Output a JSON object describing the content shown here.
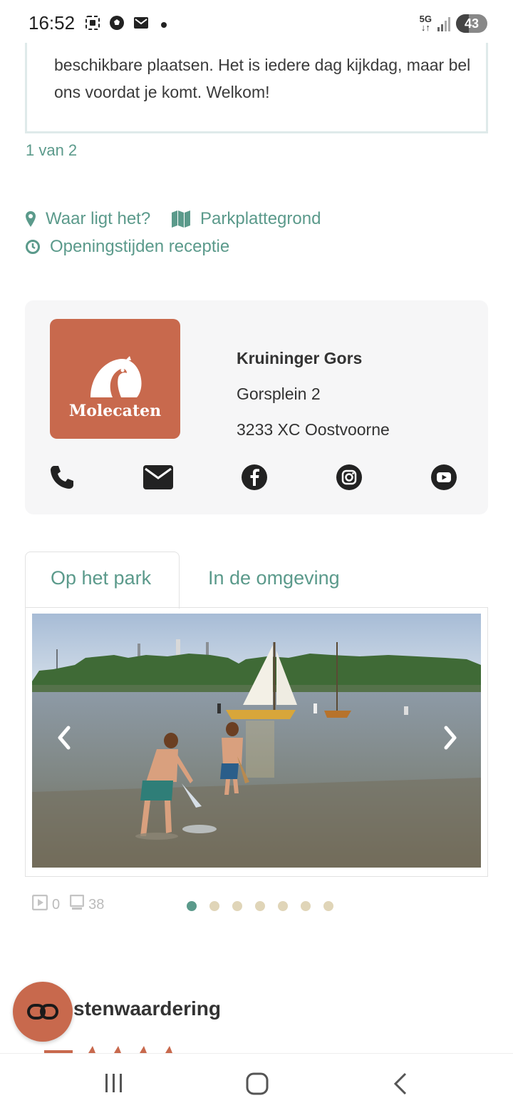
{
  "status_bar": {
    "time": "16:52",
    "battery": "43",
    "network": "5G",
    "icons": [
      "screenshot-icon",
      "soccer-icon",
      "mail-icon",
      "dot-icon"
    ]
  },
  "description": {
    "text": "beschikbare plaatsen. Het is iedere dag kijkdag, maar bel ons voordat je komt. Welkom!",
    "pager": "1 van 2"
  },
  "links": {
    "location": "Waar ligt het?",
    "map": "Parkplattegrond",
    "hours": "Openingstijden receptie"
  },
  "park": {
    "logo_text": "Molecaten",
    "name": "Kruininger Gors",
    "street": "Gorsplein 2",
    "city": "3233 XC Oostvoorne",
    "contact_icons": [
      "phone-icon",
      "email-icon",
      "facebook-icon",
      "instagram-icon",
      "youtube-icon"
    ]
  },
  "tabs": [
    {
      "label": "Op het park",
      "active": true
    },
    {
      "label": "In de omgeving",
      "active": false
    }
  ],
  "gallery": {
    "video_count": "0",
    "photo_count": "38",
    "slides": 7,
    "current_slide": 1
  },
  "reviews": {
    "title": "stenwaardering"
  },
  "colors": {
    "accent": "#5b9a8b",
    "brand": "#c8694d",
    "dot_inactive": "#e0d5b8"
  }
}
